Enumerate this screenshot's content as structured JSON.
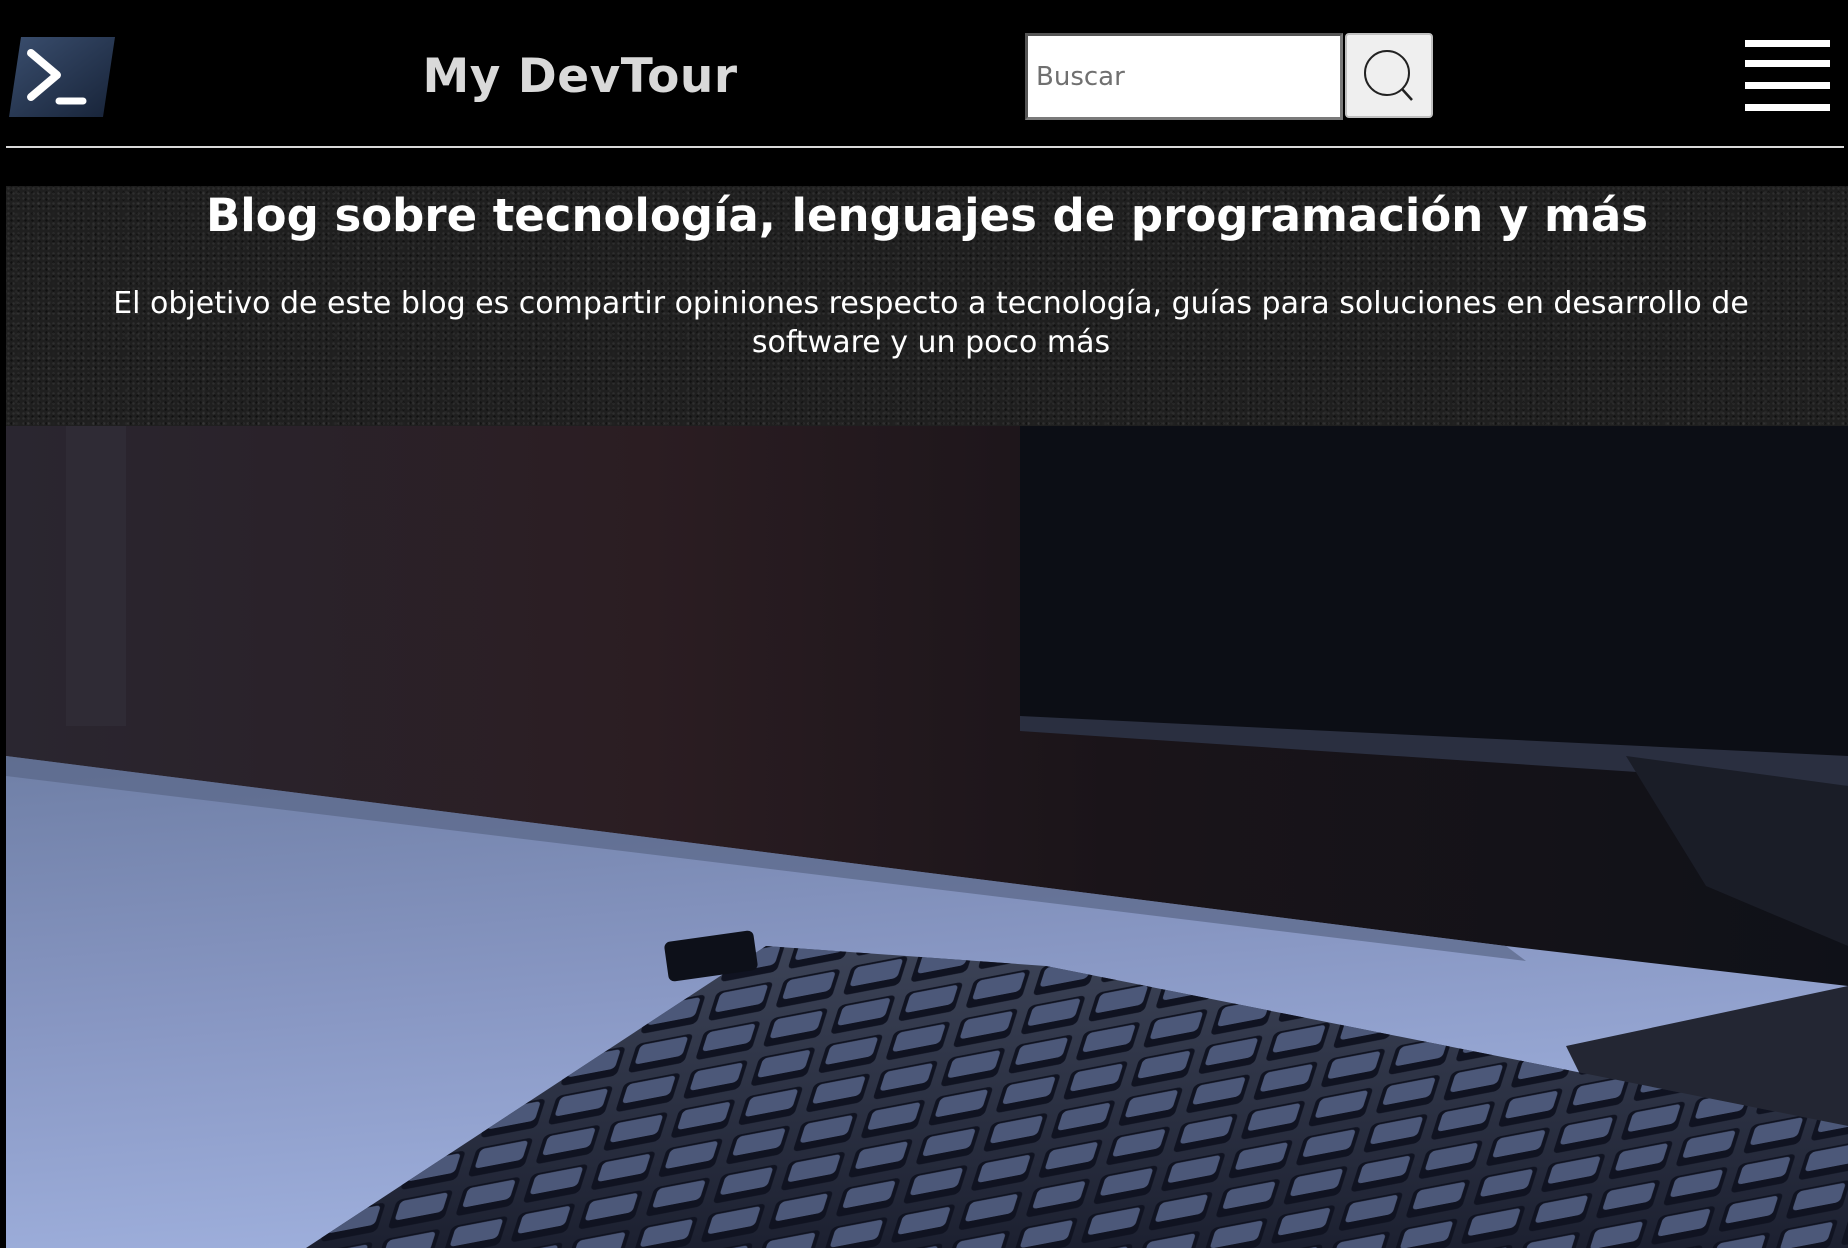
{
  "header": {
    "logo_icon": "terminal-prompt-icon",
    "brand": "My DevTour",
    "search": {
      "placeholder": "Buscar",
      "value": "",
      "button_icon": "search-icon"
    },
    "menu_icon": "hamburger-menu-icon"
  },
  "hero": {
    "title": "Blog sobre tecnología, lenguajes de programación y más",
    "description": "El objetivo de este blog es compartir opiniones respecto a tecnología, guías para soluciones en desarrollo de software y un poco más"
  },
  "featured_image": {
    "subject": "keyboard-and-monitor-on-desk-photo"
  },
  "colors": {
    "background": "#000000",
    "brand_text": "#d9d9d9",
    "hero_text": "#ffffff",
    "search_button_bg": "#efefef"
  }
}
